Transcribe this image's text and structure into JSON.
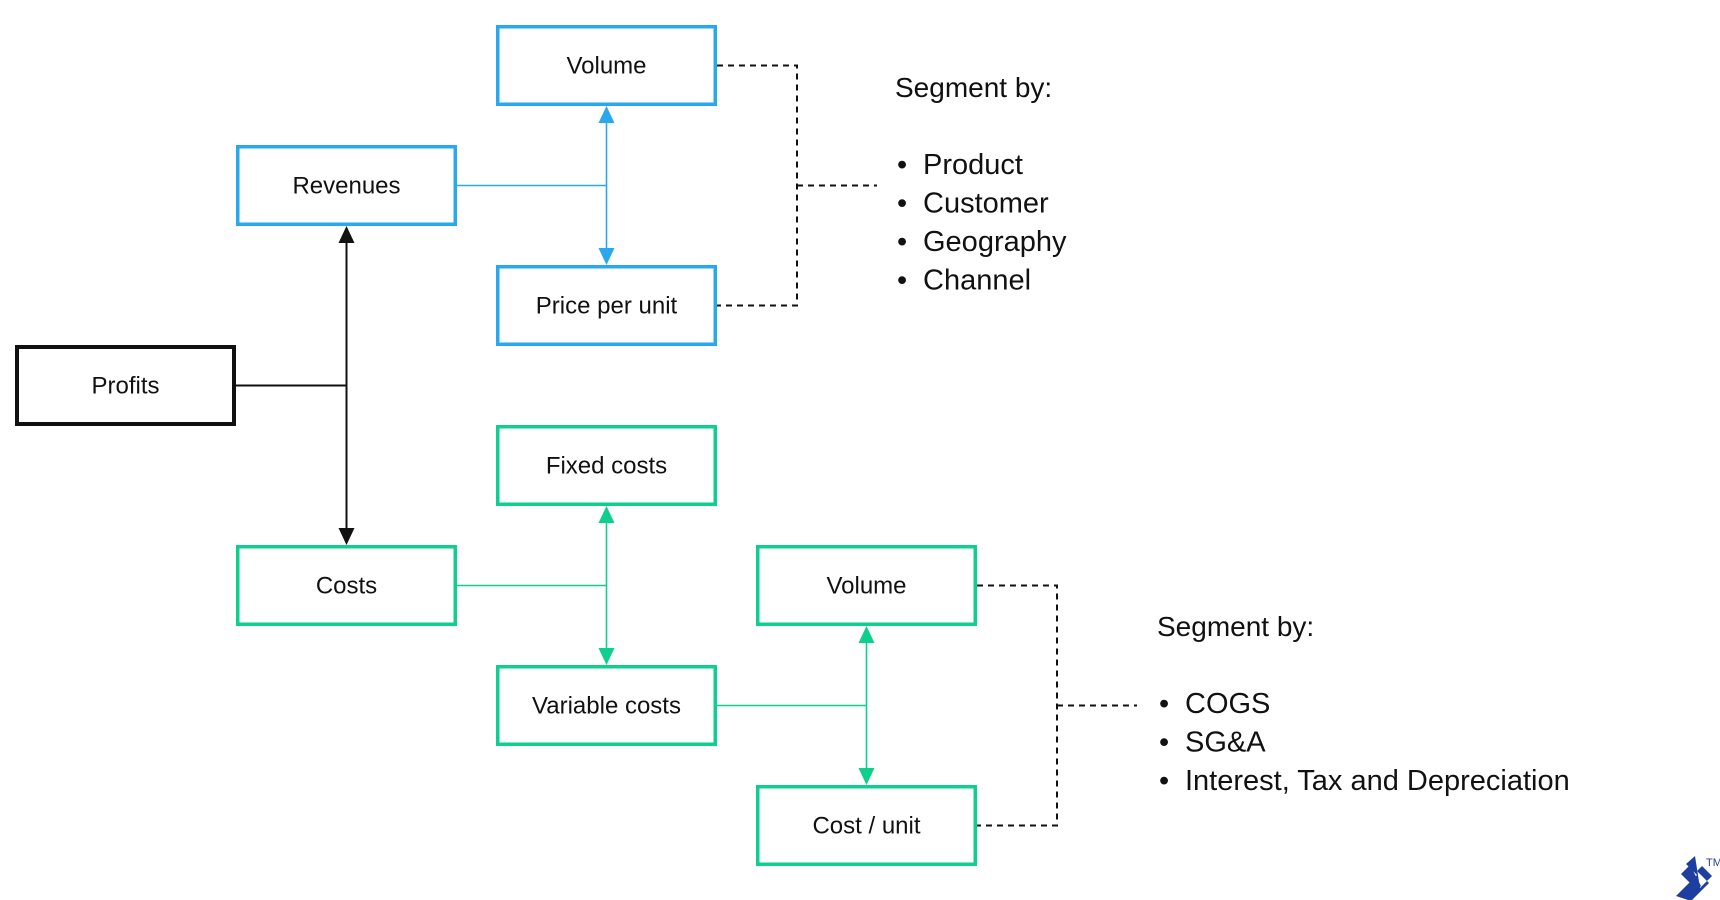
{
  "colors": {
    "revenue_group": "#2aa8ee",
    "cost_group": "#0fcf8c",
    "root": "#111111",
    "segment_connector": "#111111",
    "logo": "#1f3fa0"
  },
  "nodes": {
    "profits": {
      "label": "Profits",
      "group": "root"
    },
    "revenues": {
      "label": "Revenues",
      "group": "revenue_group"
    },
    "revenue_volume": {
      "label": "Volume",
      "group": "revenue_group"
    },
    "price_per_unit": {
      "label": "Price per unit",
      "group": "revenue_group"
    },
    "costs": {
      "label": "Costs",
      "group": "cost_group"
    },
    "fixed_costs": {
      "label": "Fixed costs",
      "group": "cost_group"
    },
    "variable_costs": {
      "label": "Variable costs",
      "group": "cost_group"
    },
    "cost_volume": {
      "label": "Volume",
      "group": "cost_group"
    },
    "cost_per_unit": {
      "label": "Cost / unit",
      "group": "cost_group"
    }
  },
  "edges": [
    {
      "from": "profits",
      "to": [
        "revenues",
        "costs"
      ],
      "style": "solid",
      "group": "root",
      "arrows": "both-targets"
    },
    {
      "from": "revenues",
      "to": [
        "revenue_volume",
        "price_per_unit"
      ],
      "style": "solid",
      "group": "revenue_group",
      "arrows": "both-targets"
    },
    {
      "from": "costs",
      "to": [
        "fixed_costs",
        "variable_costs"
      ],
      "style": "solid",
      "group": "cost_group",
      "arrows": "both-targets"
    },
    {
      "from": "variable_costs",
      "to": [
        "cost_volume",
        "cost_per_unit"
      ],
      "style": "solid",
      "group": "cost_group",
      "arrows": "both-targets"
    }
  ],
  "segments": {
    "revenue": {
      "title": "Segment by:",
      "linked_nodes": [
        "revenue_volume",
        "price_per_unit"
      ],
      "items": [
        "Product",
        "Customer",
        "Geography",
        "Channel"
      ]
    },
    "cost": {
      "title": "Segment by:",
      "linked_nodes": [
        "cost_volume",
        "cost_per_unit"
      ],
      "items": [
        "COGS",
        "SG&A",
        "Interest, Tax and Depreciation"
      ]
    }
  },
  "bullet": "•",
  "logo": {
    "name": "toptal-logo",
    "trademark": "TM"
  }
}
